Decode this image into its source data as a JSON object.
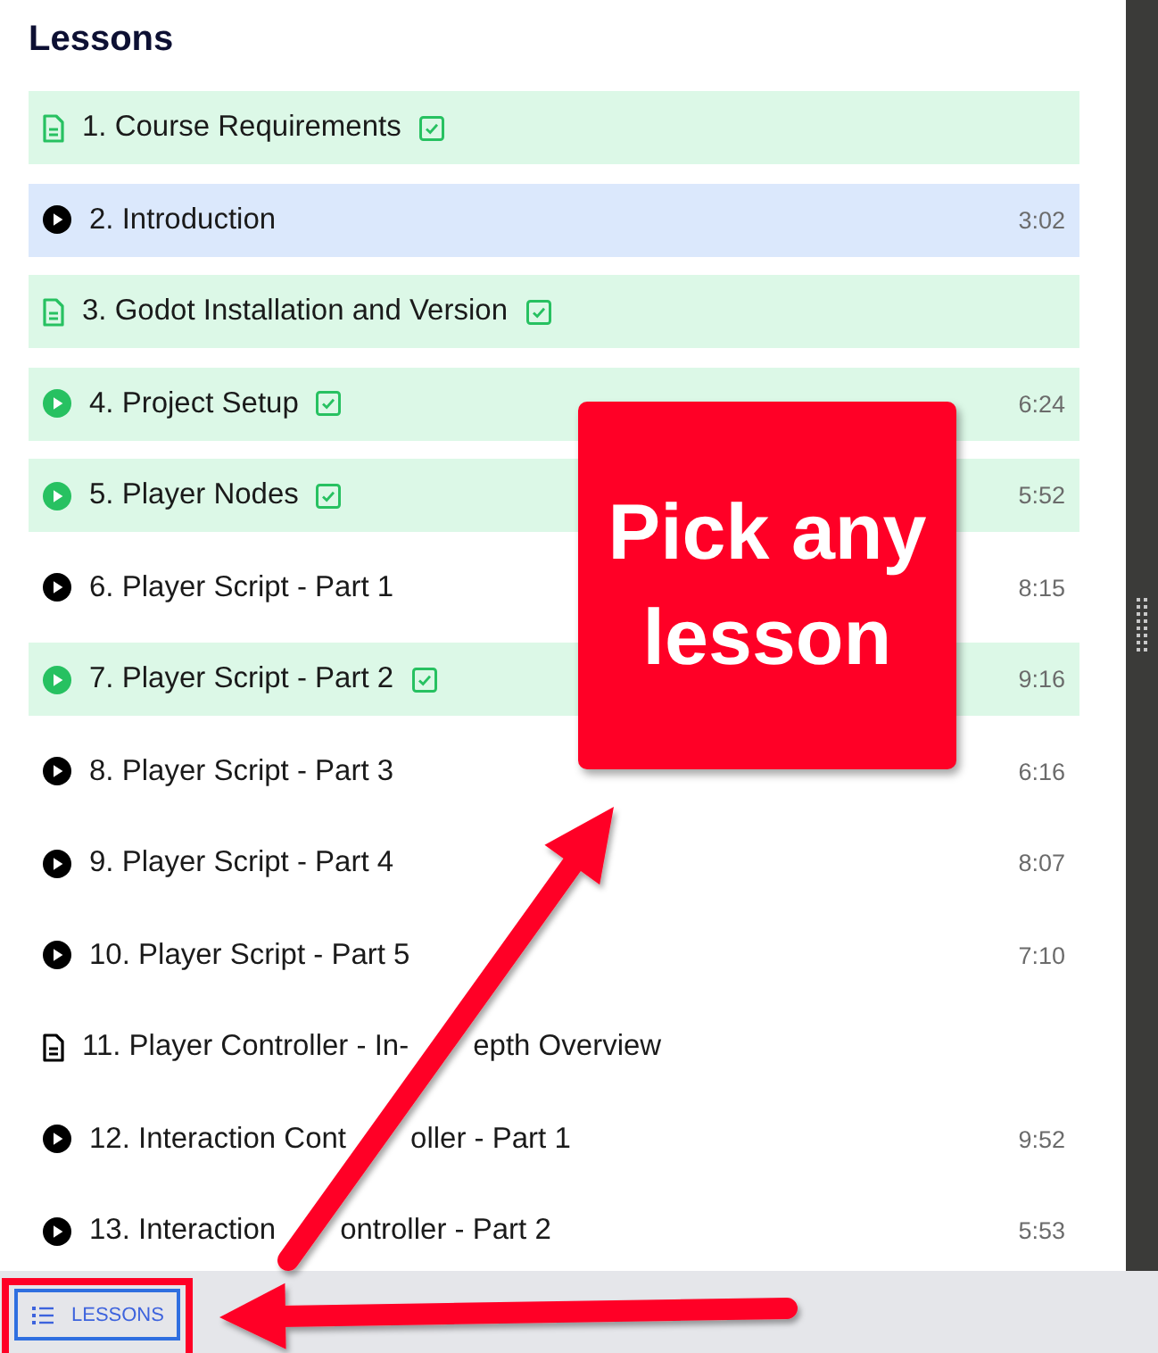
{
  "sidebar": {
    "title": "Lessons",
    "lessons": [
      {
        "kind": "document",
        "title": "1. Course Requirements",
        "completed": true,
        "selected": false
      },
      {
        "kind": "video",
        "title": "2. Introduction",
        "completed": false,
        "selected": true,
        "duration": "3:02"
      },
      {
        "kind": "document",
        "title": "3. Godot Installation and Version",
        "completed": true,
        "selected": false
      },
      {
        "kind": "video",
        "title": "4. Project Setup",
        "completed": true,
        "selected": false,
        "duration": "6:24"
      },
      {
        "kind": "video",
        "title": "5. Player Nodes",
        "completed": true,
        "selected": false,
        "duration": "5:52"
      },
      {
        "kind": "video",
        "title": "6. Player Script - Part 1",
        "completed": false,
        "selected": false,
        "duration": "8:15"
      },
      {
        "kind": "video",
        "title": "7. Player Script - Part 2",
        "completed": true,
        "selected": false,
        "duration": "9:16"
      },
      {
        "kind": "video",
        "title": "8. Player Script - Part 3",
        "completed": false,
        "selected": false,
        "duration": "6:16"
      },
      {
        "kind": "video",
        "title": "9. Player Script - Part 4",
        "completed": false,
        "selected": false,
        "duration": "8:07"
      },
      {
        "kind": "video",
        "title": "10. Player Script - Part 5",
        "completed": false,
        "selected": false,
        "duration": "7:10"
      },
      {
        "kind": "document",
        "title_parts": [
          "11. Player Controller - In-",
          "epth Overview"
        ],
        "completed": false,
        "selected": false
      },
      {
        "kind": "video",
        "title_parts": [
          "12. Interaction Cont",
          "oller - Part 1"
        ],
        "completed": false,
        "selected": false,
        "duration": "9:52"
      },
      {
        "kind": "video",
        "title_parts": [
          "13. Interaction",
          "ontroller - Part 2"
        ],
        "completed": false,
        "selected": false,
        "duration": "5:53"
      }
    ]
  },
  "bottom_bar": {
    "button": {
      "label": "LESSONS"
    }
  },
  "callout": {
    "text": "Pick any lesson"
  }
}
